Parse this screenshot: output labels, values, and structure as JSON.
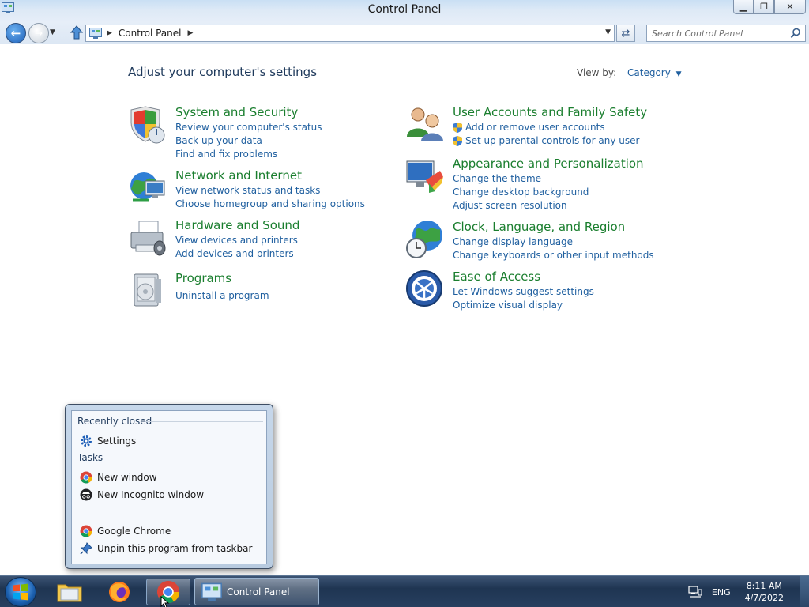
{
  "window": {
    "title": "Control Panel",
    "minimize_glyph": "▁",
    "maximize_glyph": "❐",
    "close_glyph": "✕"
  },
  "nav": {
    "breadcrumb": "Control Panel",
    "search_placeholder": "Search Control Panel"
  },
  "main": {
    "heading": "Adjust your computer's settings",
    "view_by_label": "View by:",
    "view_by_value": "Category",
    "left_categories": [
      {
        "title": "System and Security",
        "icon": "shield-icon",
        "links": [
          "Review your computer's status",
          "Back up your data",
          "Find and fix problems"
        ]
      },
      {
        "title": "Network and Internet",
        "icon": "network-icon",
        "links": [
          "View network status and tasks",
          "Choose homegroup and sharing options"
        ]
      },
      {
        "title": "Hardware and Sound",
        "icon": "printer-icon",
        "links": [
          "View devices and printers",
          "Add devices and printers"
        ]
      },
      {
        "title": "Programs",
        "icon": "programs-icon",
        "links": [
          "Uninstall a program"
        ]
      }
    ],
    "right_categories": [
      {
        "title": "User Accounts and Family Safety",
        "icon": "users-icon",
        "links": [
          "Add or remove user accounts",
          "Set up parental controls for any user"
        ]
      },
      {
        "title": "Appearance and Personalization",
        "icon": "appearance-icon",
        "links": [
          "Change the theme",
          "Change desktop background",
          "Adjust screen resolution"
        ]
      },
      {
        "title": "Clock, Language, and Region",
        "icon": "clock-globe-icon",
        "links": [
          "Change display language",
          "Change keyboards or other input methods"
        ]
      },
      {
        "title": "Ease of Access",
        "icon": "ease-of-access-icon",
        "links": [
          "Let Windows suggest settings",
          "Optimize visual display"
        ]
      }
    ]
  },
  "jumplist": {
    "recent_header": "Recently closed",
    "recent_items": [
      "Settings"
    ],
    "tasks_header": "Tasks",
    "task_items": [
      "New window",
      "New Incognito window"
    ],
    "pinned_items": [
      "Google Chrome",
      "Unpin this program from taskbar"
    ]
  },
  "taskbar": {
    "active_window": "Control Panel",
    "language": "ENG",
    "time": "8:11 AM",
    "date": "4/7/2022"
  },
  "colors": {
    "category_title": "#1a7e2e",
    "link": "#1f5f9f",
    "heading": "#1e395b"
  }
}
